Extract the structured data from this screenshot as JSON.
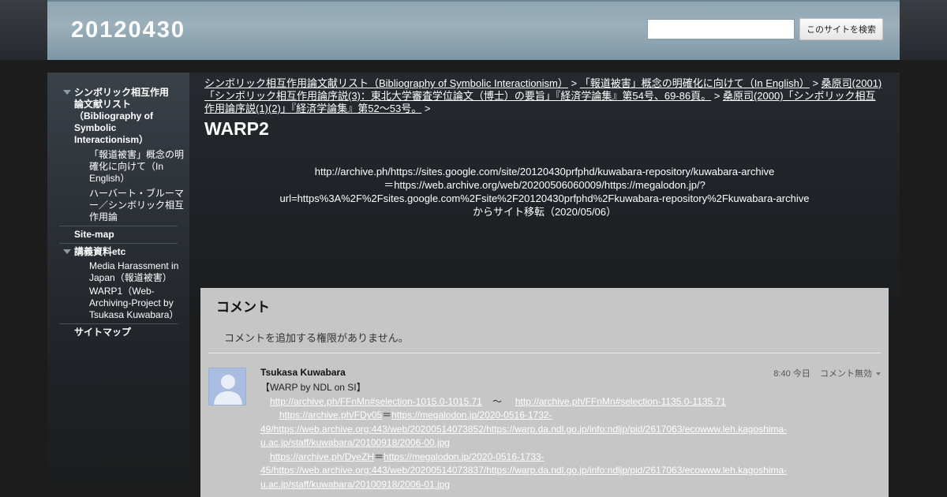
{
  "site": {
    "title": "20120430"
  },
  "search": {
    "placeholder": "",
    "button_label": "このサイトを検索"
  },
  "sidebar": {
    "items": [
      {
        "label": "シンボリック相互作用論文献リスト（Bibliography of Symbolic Interactionism）",
        "level": 0,
        "expanded": true
      },
      {
        "label": "「報道被害」概念の明確化に向けて（In English）",
        "level": 1
      },
      {
        "label": "ハーバート・ブルーマー／シンボリック相互作用論",
        "level": 1
      },
      {
        "label": "Site-map",
        "level": 0
      },
      {
        "label": "講義資料etc",
        "level": 0,
        "expanded": true
      },
      {
        "label": "Media Harassment in Japan（報道被害）",
        "level": 1
      },
      {
        "label": "WARP1（Web-Archiving-Project by Tsukasa Kuwabara）",
        "level": 1
      },
      {
        "label": "サイトマップ",
        "level": 0
      }
    ]
  },
  "breadcrumb": {
    "links": [
      "シンボリック相互作用論文献リスト（Bibliography of Symbolic Interactionism）",
      "「報道被害」概念の明確化に向けて（In English）",
      "桑原司(2001)「シンボリック相互作用論序説(3)：東北大学審査学位論文（博士）の要旨」『経済学論集』第54号、69-86頁。",
      "桑原司(2000)「シンボリック相互作用論序説(1)(2)」『経済学論集』第52～53号。"
    ],
    "separator": ">"
  },
  "page": {
    "title": "WARP2",
    "body_lines": [
      "http://archive.ph/https://sites.google.com/site/20120430prfphd/kuwabara-repository/kuwabara-archive",
      "＝https://web.archive.org/web/20200506060009/https://megalodon.jp/?",
      "url=https%3A%2F%2Fsites.google.com%2Fsite%2F20120430prfphd%2Fkuwabara-repository%2Fkuwabara-archive",
      "からサイト移転（2020/05/06）"
    ]
  },
  "comments": {
    "heading": "コメント",
    "no_permission": "コメントを追加する権限がありません。",
    "items": [
      {
        "author": "Tsukasa Kuwabara",
        "time": "8:40 今日",
        "action": "コメント無効",
        "title_line": "【WARP by NDL on SI】",
        "link1": "http://archive.ph/FFnMn#selection-1015.0-1015.71",
        "tilde": "～",
        "link2": "http://archive.ph/FFnMn#selection-1135.0-1135.71",
        "short1": "https://archive.ph/FDy05",
        "long1": "https://megalodon.jp/2020-0516-1732-49/https://web.archive.org:443/web/20200514073852/https://warp.da.ndl.go.jp/info:ndljp/pid/2617063/ecowww.leh.kagoshima-u.ac.jp/staff/kuwabara/20100918/2006-00.jpg",
        "short2": "https://archive.ph/DyeZH",
        "long2": "https://megalodon.jp/2020-0516-1733-45/https://web.archive.org:443/web/20200514073837/https://warp.da.ndl.go.jp/info:ndljp/pid/2617063/ecowww.leh.kagoshima-u.ac.jp/staff/kuwabara/20100918/2006-01.jpg",
        "equals": "＝"
      }
    ]
  }
}
